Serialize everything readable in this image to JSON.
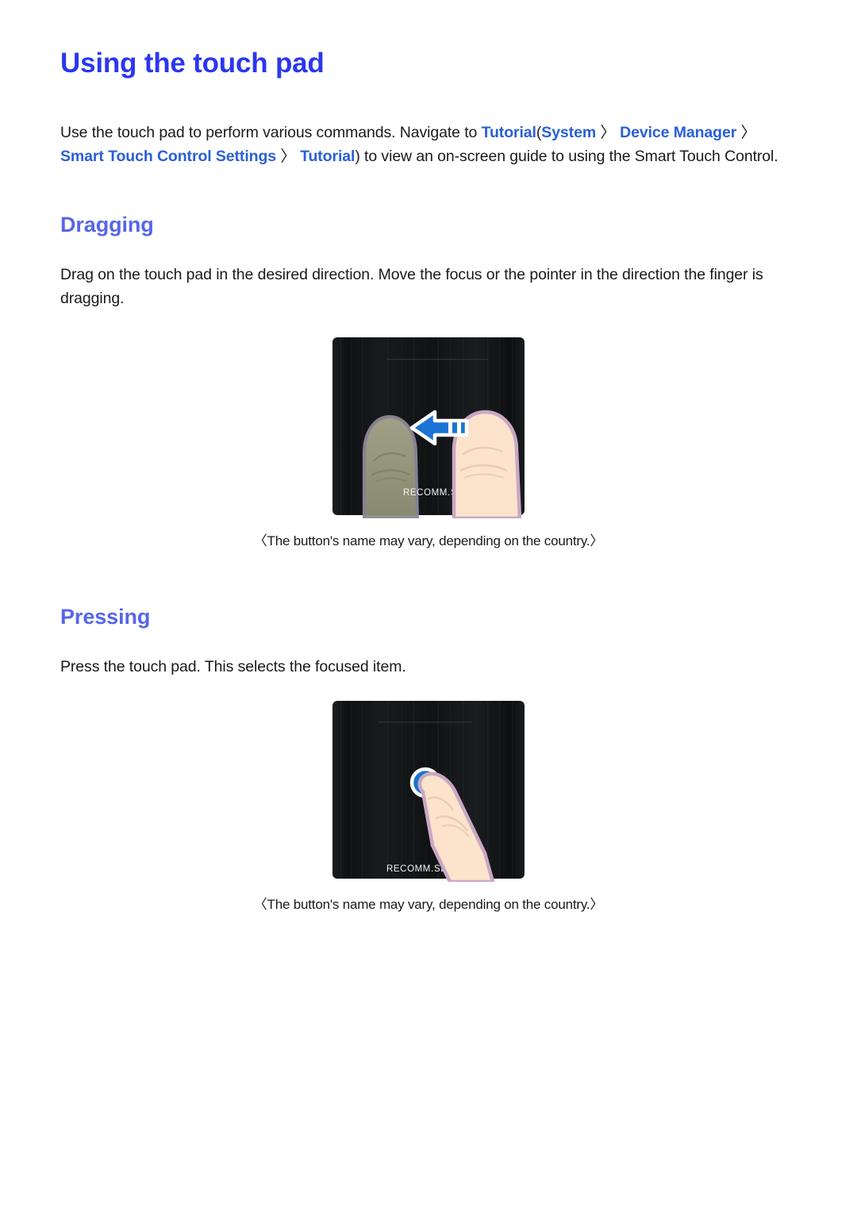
{
  "document": {
    "title": "Using the touch pad",
    "title_color": "#2b37ef",
    "section_heading_color": "#5766e8",
    "link_color": "#2a5fd6",
    "body_color": "#1a1a1a",
    "background_color": "#ffffff"
  },
  "intro": {
    "text_before_link": "Use the touch pad to perform various commands. Navigate to ",
    "link_tutorial_1": "Tutorial",
    "open_paren": "(",
    "link_system": "System",
    "separator_1": "〉",
    "link_device_manager": "Device Manager",
    "separator_2": "〉",
    "link_smart_touch_control_settings": "Smart Touch Control Settings",
    "separator_3": "〉",
    "link_tutorial_2": "Tutorial",
    "close_paren": ")",
    "text_after_link": " to view an on-screen guide to using the Smart Touch Control."
  },
  "sections": [
    {
      "heading": "Dragging",
      "body": "Drag on the touch pad in the desired direction. Move the focus or the pointer in the direction the finger is dragging.",
      "figure": {
        "name": "touch-pad-dragging-illustration",
        "type": "dragging",
        "pad_color": "#141618",
        "arrow_color": "#1b74d4",
        "arrow_outline_color": "#ffffff",
        "arrow_direction": "left",
        "skin_color": "#fce3cc",
        "skin_outline_color": "#c9a7c4",
        "ghost_finger_color": "#9a9b7e",
        "button_label_left": "RECOMM.",
        "button_label_right": "SEARCH",
        "caption": "〈The button's name may vary, depending on the country.〉"
      }
    },
    {
      "heading": "Pressing",
      "body": "Press the touch pad. This selects the focused item.",
      "figure": {
        "name": "touch-pad-pressing-illustration",
        "type": "pressing",
        "pad_color": "#141618",
        "press_dot_color": "#1a73d0",
        "press_dot_outline_color": "#ffffff",
        "skin_color": "#fce3cc",
        "skin_outline_color": "#c9a7c4",
        "button_label_left": "RECOMM.",
        "button_label_right": "SEARC",
        "caption": "〈The button's name may vary, depending on the country.〉"
      }
    }
  ]
}
